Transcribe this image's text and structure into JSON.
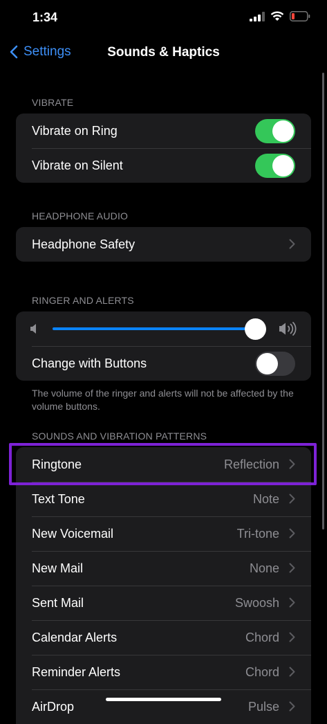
{
  "status_bar": {
    "time": "1:34"
  },
  "nav": {
    "back_label": "Settings",
    "title": "Sounds & Haptics"
  },
  "sections": {
    "vibrate": {
      "header": "VIBRATE",
      "rows": [
        {
          "label": "Vibrate on Ring",
          "on": true
        },
        {
          "label": "Vibrate on Silent",
          "on": true
        }
      ]
    },
    "headphone": {
      "header": "HEADPHONE AUDIO",
      "rows": [
        {
          "label": "Headphone Safety"
        }
      ]
    },
    "ringer": {
      "header": "RINGER AND ALERTS",
      "volume_level": 1.0,
      "change_with_buttons": {
        "label": "Change with Buttons",
        "on": false
      },
      "footer": "The volume of the ringer and alerts will not be affected by the volume buttons."
    },
    "patterns": {
      "header": "SOUNDS AND VIBRATION PATTERNS",
      "rows": [
        {
          "label": "Ringtone",
          "value": "Reflection"
        },
        {
          "label": "Text Tone",
          "value": "Note"
        },
        {
          "label": "New Voicemail",
          "value": "Tri-tone"
        },
        {
          "label": "New Mail",
          "value": "None"
        },
        {
          "label": "Sent Mail",
          "value": "Swoosh"
        },
        {
          "label": "Calendar Alerts",
          "value": "Chord"
        },
        {
          "label": "Reminder Alerts",
          "value": "Chord"
        },
        {
          "label": "AirDrop",
          "value": "Pulse"
        }
      ]
    }
  },
  "colors": {
    "accent": "#3d8ff7",
    "toggle_on": "#34c759",
    "highlight": "#7d22d6"
  }
}
